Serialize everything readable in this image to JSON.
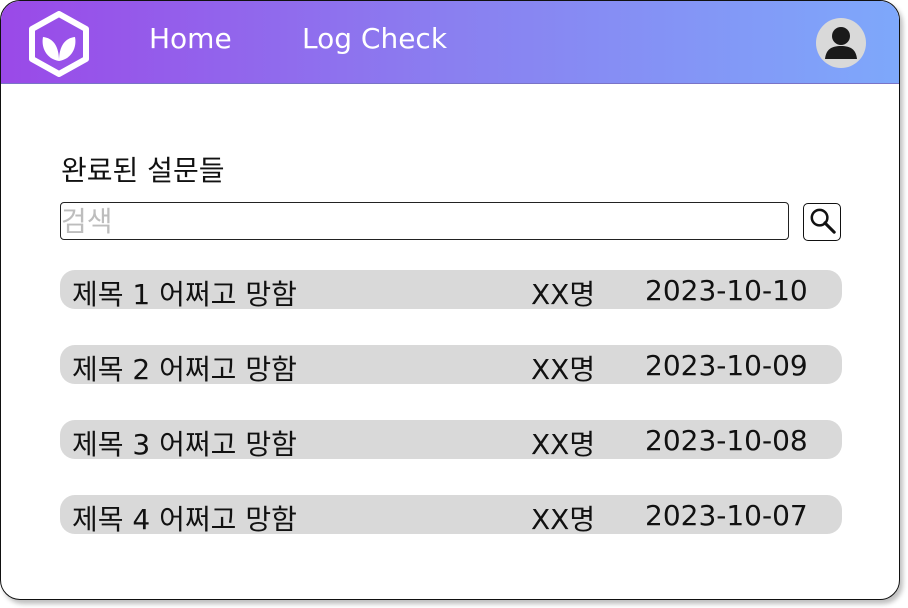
{
  "header": {
    "nav": [
      {
        "label": "Home"
      },
      {
        "label": "Log Check"
      }
    ]
  },
  "section": {
    "title": "완료된 설문들"
  },
  "search": {
    "placeholder": "검색",
    "value": ""
  },
  "surveys": [
    {
      "title": "제목 1 어쩌고 망함",
      "count": "XX명",
      "date": "2023-10-10"
    },
    {
      "title": "제목 2 어쩌고 망함",
      "count": "XX명",
      "date": "2023-10-09"
    },
    {
      "title": "제목 3 어쩌고 망함",
      "count": "XX명",
      "date": "2023-10-08"
    },
    {
      "title": "제목 4 어쩌고 망함",
      "count": "XX명",
      "date": "2023-10-07"
    }
  ],
  "colors": {
    "header_start": "#9a49e8",
    "header_end": "#7ea8fb",
    "row_bg": "#d9d9d9"
  },
  "icons": {
    "logo": "leaf-hexagon-icon",
    "avatar": "user-icon",
    "search": "search-icon"
  }
}
